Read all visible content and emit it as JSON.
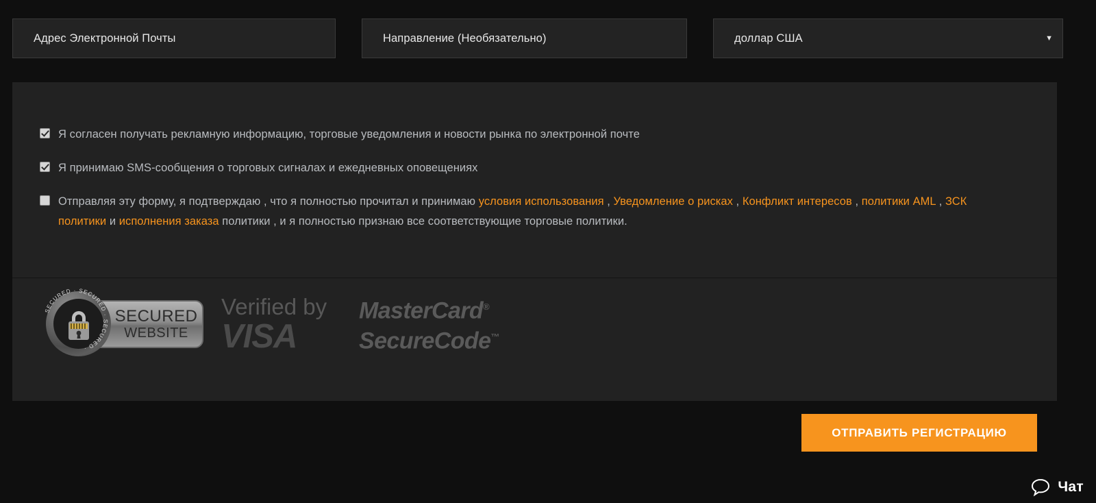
{
  "form": {
    "email_field": {
      "placeholder": "Адрес Электронной Почты",
      "value": ""
    },
    "direction_field": {
      "placeholder": "Направление (Необязательно)",
      "value": ""
    },
    "currency_select": {
      "value": "доллар США",
      "caret": "▼"
    }
  },
  "consents": [
    {
      "name": "marketing",
      "checked": true,
      "text": "Я согласен получать рекламную информацию, торговые уведомления и новости рынка по электронной почте"
    },
    {
      "name": "sms",
      "checked": true,
      "text": "Я принимаю SMS-сообщения о торговых сигналах и ежедневных оповещениях"
    }
  ],
  "terms": {
    "checked": false,
    "part1": "Отправляя эту форму, я подтверждаю , что я полностью прочитал и принимаю ",
    "link_terms": "условия использования",
    "sep1": " , ",
    "link_risk": "Уведомление о рисках",
    "sep2": " , ",
    "link_conflict": "Конфликт интересов",
    "sep3": " , ",
    "link_aml": "политики AML",
    "sep4": " , ",
    "link_kyc": "ЗСК политики",
    "sep5": " и ",
    "link_execution": "исполнения заказа",
    "part2": " политики , и я полностью признаю все соответствующие торговые политики."
  },
  "badges": {
    "secured": {
      "ring_text": "SECURED · SECURED ·",
      "line1": "SECURED",
      "line2": "WEBSITE",
      "icon": "padlock-icon"
    },
    "visa": {
      "line1": "Verified by",
      "line2": "VISA"
    },
    "mastercard": {
      "line1": "MasterCard",
      "line1_mark": "®",
      "line2": "SecureCode",
      "line2_mark": "™"
    }
  },
  "submit": {
    "label": "ОТПРАВИТЬ РЕГИСТРАЦИЮ"
  },
  "chat": {
    "label": "Чат",
    "icon": "chat-bubble-icon"
  },
  "colors": {
    "page_background": "#0f0f0f",
    "panel_background": "#222222",
    "field_background": "#232323",
    "accent_orange": "#f7941e",
    "text_primary": "#e8e8e8",
    "text_secondary": "#b9bcc0"
  }
}
